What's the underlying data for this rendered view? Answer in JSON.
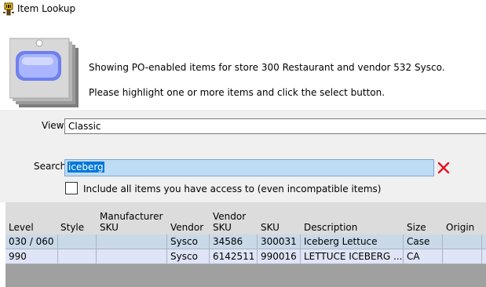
{
  "window": {
    "title": "Item Lookup",
    "title_icon": "barcode-scanner-icon"
  },
  "header": {
    "icon": "item-card-icon",
    "info_line": "Showing PO-enabled items for store 300 Restaurant and vendor 532 Sysco.",
    "instruction_line": "Please highlight one or more items and click the select button."
  },
  "form": {
    "view_label": "View",
    "view_value": "Classic",
    "search_label": "Search",
    "search_value": "iceberg",
    "clear_icon": "clear-x-icon",
    "clear_color": "#e81123",
    "include_all_label": "Include all items you have access to (even incompatible items)",
    "include_all_checked": false
  },
  "grid": {
    "columns": [
      {
        "key": "level",
        "label": "Level"
      },
      {
        "key": "style",
        "label": "Style"
      },
      {
        "key": "mfr_sku",
        "label": "Manufacturer\nSKU"
      },
      {
        "key": "vendor",
        "label": "Vendor"
      },
      {
        "key": "vendor_sku",
        "label": "Vendor\nSKU"
      },
      {
        "key": "sku",
        "label": "SKU"
      },
      {
        "key": "description",
        "label": "Description"
      },
      {
        "key": "size",
        "label": "Size"
      },
      {
        "key": "origin",
        "label": "Origin"
      }
    ],
    "rows": [
      {
        "level": "030 / 060",
        "style": "",
        "mfr_sku": "",
        "vendor": "Sysco",
        "vendor_sku": "34586",
        "sku": "300031",
        "description": "Iceberg Lettuce",
        "size": "Case",
        "origin": ""
      },
      {
        "level": "990",
        "style": "",
        "mfr_sku": "",
        "vendor": "Sysco",
        "vendor_sku": "6142511",
        "sku": "990016",
        "description": "LETTUCE ICEBERG ...",
        "size": "CA",
        "origin": ""
      }
    ]
  }
}
